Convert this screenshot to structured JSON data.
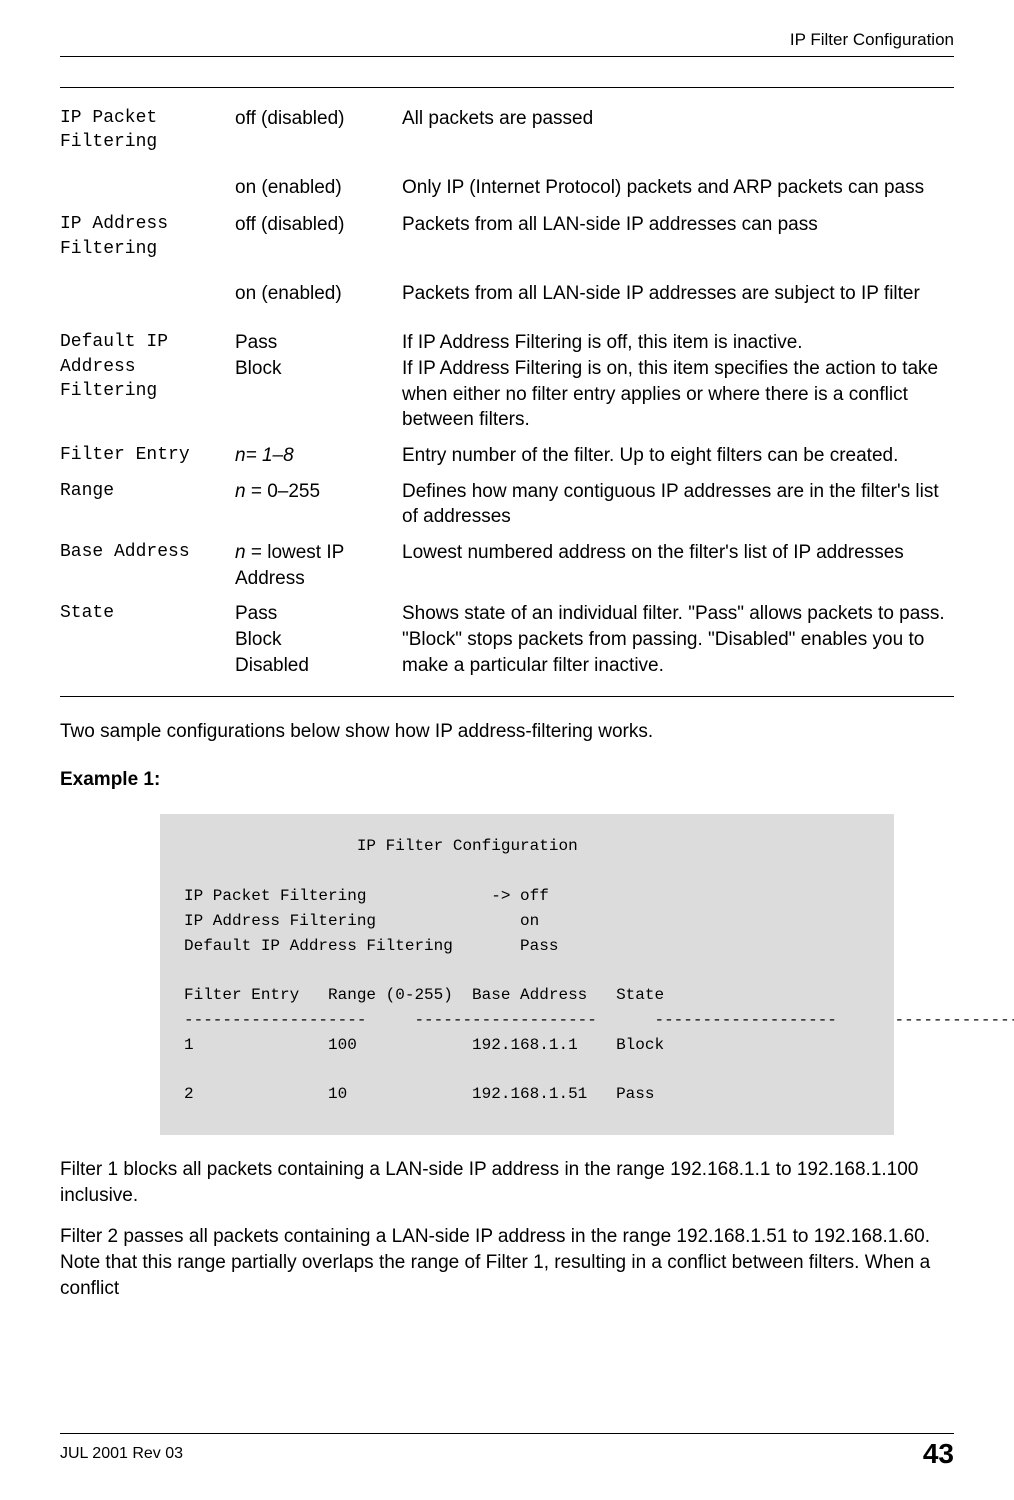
{
  "header": "IP Filter Configuration",
  "rows": [
    {
      "name": "IP Packet\nFiltering",
      "val": "off (disabled)",
      "desc": "All packets are passed"
    },
    {
      "name": "",
      "val": "on (enabled)",
      "desc": "Only IP (Internet Protocol) packets and ARP packets can pass"
    },
    {
      "name": "IP Address\nFiltering",
      "val": "off (disabled)",
      "desc": "Packets from all LAN-side IP addresses can pass"
    },
    {
      "name": "",
      "val": "on (enabled)",
      "desc": "Packets from all LAN-side IP addresses are subject to IP filter"
    },
    {
      "name": "Default IP\nAddress\nFiltering",
      "val": "Pass\nBlock",
      "desc": "If IP Address Filtering is off, this item is inactive.\nIf IP Address Filtering is on, this item specifies the action to take when either no filter entry applies or where there is a conflict between filters."
    },
    {
      "name": "Filter Entry",
      "val_html": "<span class='italic'>n= 1–8</span>",
      "desc": "Entry number of the filter. Up to eight filters can be created."
    },
    {
      "name": "Range",
      "val_html": "<span class='italic'>n</span> = 0–255",
      "desc": "Defines how many contiguous IP addresses are in the filter's list of addresses"
    },
    {
      "name": "Base Address",
      "val_html": "<span class='italic'>n</span> = lowest IP Address",
      "desc": "Lowest numbered address on the filter's list of IP addresses"
    },
    {
      "name": "State",
      "val": "Pass\nBlock\nDisabled",
      "desc": "Shows state of an individual filter.  \"Pass\" allows packets to pass. \"Block\" stops packets from passing. \"Disabled\" enables you to make a particular filter inactive."
    }
  ],
  "intro_para": "Two sample configurations below show how IP address-filtering works.",
  "example_label": "Example 1:",
  "example_box": "                  IP Filter Configuration\n\nIP Packet Filtering             -> off\nIP Address Filtering               on\nDefault IP Address Filtering       Pass\n\nFilter Entry   Range (0-255)  Base Address   State\n-------------------     -------------------      -------------------      -------------------\n1              100            192.168.1.1    Block\n\n2              10             192.168.1.51   Pass",
  "para_after_1": "Filter 1 blocks all packets containing a LAN-side IP address in the range 192.168.1.1 to 192.168.1.100 inclusive.",
  "para_after_2": "Filter 2  passes all packets containing a LAN-side IP address in the range 192.168.1.51 to 192.168.1.60.  Note that this range partially overlaps the range of Filter 1, resulting in a conflict between filters.  When a conflict",
  "footer_left": "JUL 2001 Rev 03",
  "footer_right": "43"
}
